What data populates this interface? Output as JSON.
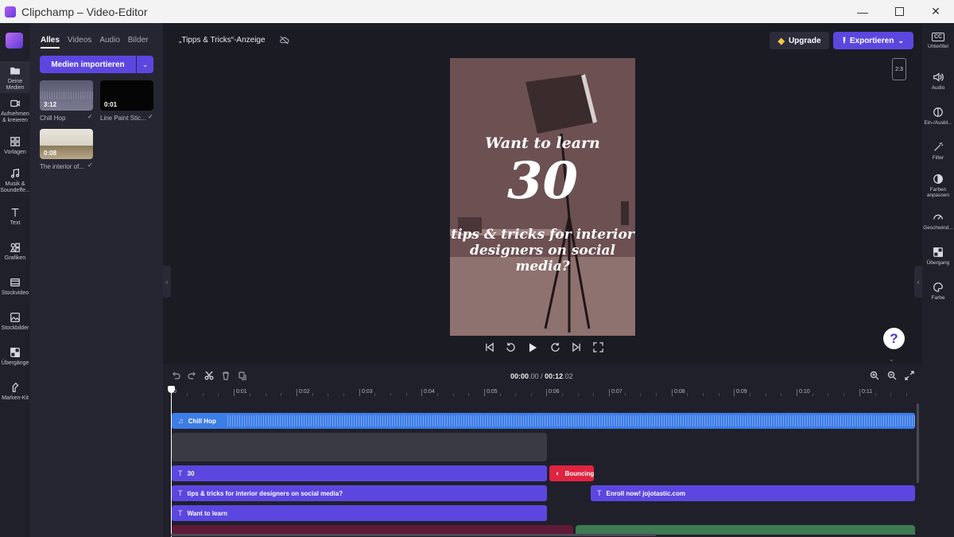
{
  "window": {
    "title": "Clipchamp – Video-Editor",
    "min": "—",
    "close": "✕"
  },
  "rail": [
    {
      "label": "Deine Medien"
    },
    {
      "label": "Aufnehmen & kreieren"
    },
    {
      "label": "Vorlagen"
    },
    {
      "label": "Musik & Soundeffe..."
    },
    {
      "label": "Text"
    },
    {
      "label": "Grafiken"
    },
    {
      "label": "Stockvideo"
    },
    {
      "label": "Stockbilder"
    },
    {
      "label": "Übergänge"
    },
    {
      "label": "Marken-Kit"
    }
  ],
  "media": {
    "tabs": [
      "Alles",
      "Videos",
      "Audio",
      "Bilder"
    ],
    "import_label": "Medien importieren",
    "items": [
      {
        "duration": "3:12",
        "name": "Chill Hop"
      },
      {
        "duration": "0:01",
        "name": "Line Paint Stic..."
      },
      {
        "duration": "0:08",
        "name": "The interior of..."
      }
    ],
    "check": "✓"
  },
  "stage": {
    "project_name": "„Tipps & Tricks“-Anzeige",
    "upgrade_label": "Upgrade",
    "export_label": "Exportieren",
    "aspect_ratio": "2:3",
    "help": "?",
    "preview": {
      "line1": "Want to learn",
      "line2": "30",
      "line3": "tips & tricks for interior designers on social media?"
    }
  },
  "rpanel": [
    {
      "label": "Untertitel"
    },
    {
      "label": "Audio"
    },
    {
      "label": "Ein-/Ausbl..."
    },
    {
      "label": "Filter"
    },
    {
      "label": "Farben anpassen"
    },
    {
      "label": "Geschwind..."
    },
    {
      "label": "Übergang"
    },
    {
      "label": "Farbe"
    }
  ],
  "rpanel_badge": "CC",
  "timeline": {
    "time_current_main": "00:00",
    "time_current_sub": ".00",
    "time_sep": " / ",
    "time_total_main": "00:12",
    "time_total_sub": ".02",
    "ruler": [
      "0",
      "0:01",
      "0:02",
      "0:03",
      "0:04",
      "0:05",
      "0:06",
      "0:07",
      "0:08",
      "0:09",
      "0:10",
      "0:11"
    ],
    "clips": {
      "audio": "Chill Hop",
      "t30": "30",
      "bouncing": "Bouncing",
      "tips": "tips & tricks for interior designers on social media?",
      "enroll": "Enroll now! jojotastic.com",
      "want": "Want to learn"
    }
  },
  "colors": {
    "accent": "#5b47e0",
    "audio": "#3c7de6",
    "red": "#e0233f"
  }
}
